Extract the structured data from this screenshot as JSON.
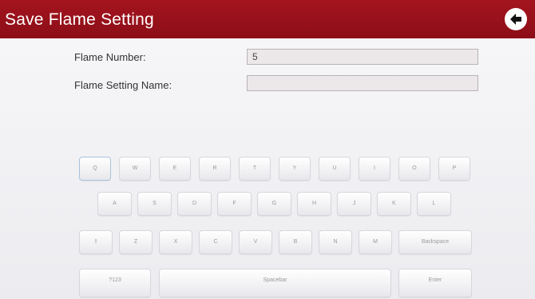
{
  "header": {
    "title": "Save Flame Setting",
    "back_icon": "back-arrow-icon"
  },
  "form": {
    "flame_number_label": "Flame Number:",
    "flame_number_value": "5",
    "flame_setting_name_label": "Flame Setting Name:",
    "flame_setting_name_value": ""
  },
  "keyboard": {
    "row1": [
      "Q",
      "W",
      "E",
      "R",
      "T",
      "Y",
      "U",
      "I",
      "O",
      "P"
    ],
    "row2": [
      "A",
      "S",
      "D",
      "F",
      "G",
      "H",
      "J",
      "K",
      "L"
    ],
    "row3": [
      "⇧",
      "Z",
      "X",
      "C",
      "V",
      "B",
      "N",
      "M",
      "Backspace"
    ],
    "row4": [
      "?123",
      "Spacebar",
      "Enter"
    ]
  }
}
